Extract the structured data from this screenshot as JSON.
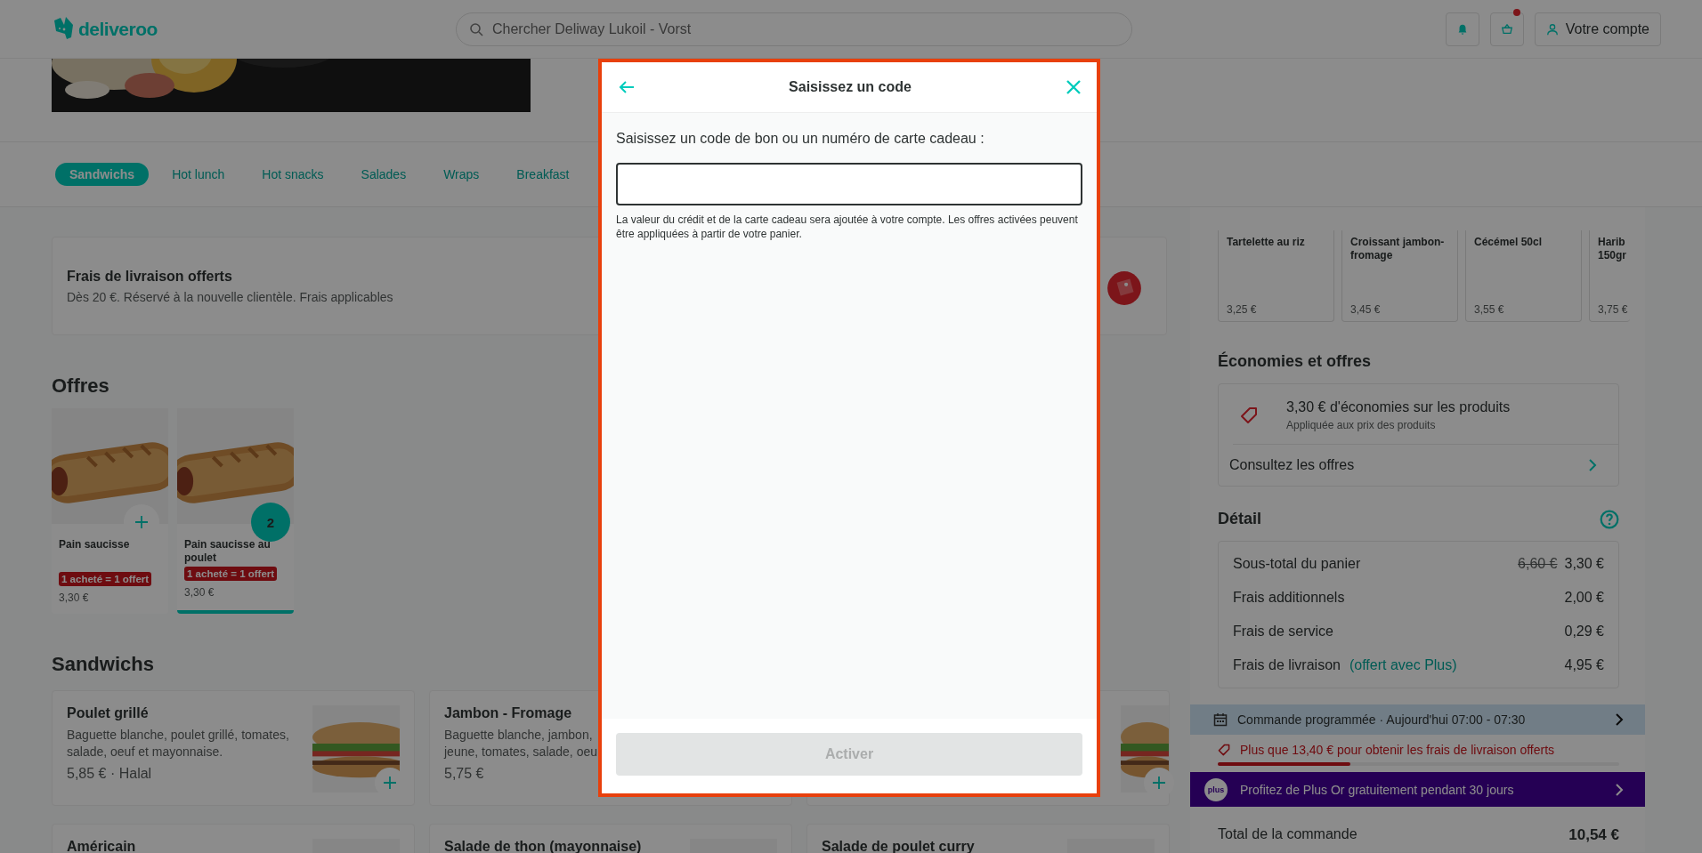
{
  "header": {
    "logo": "deliveroo",
    "search": {
      "placeholder": "Chercher Deliway Lukoil - Vorst"
    },
    "basket_dot": true,
    "account": "Votre compte"
  },
  "categories": [
    {
      "label": "Sandwichs",
      "selected": true
    },
    {
      "label": "Hot lunch",
      "selected": false
    },
    {
      "label": "Hot snacks",
      "selected": false
    },
    {
      "label": "Salades",
      "selected": false
    },
    {
      "label": "Wraps",
      "selected": false
    },
    {
      "label": "Breakfast",
      "selected": false
    }
  ],
  "promo": {
    "title": "Frais de livraison offerts",
    "text": "Dès 20 €. Réservé à la nouvelle clientèle. Frais applicables"
  },
  "offers": {
    "title": "Offres",
    "items": [
      {
        "name": "Pain saucisse",
        "badge": "1 acheté = 1 offert",
        "price": "3,30 €",
        "in_basket": false
      },
      {
        "name": "Pain saucisse au poulet",
        "badge": "1 acheté = 1 offert",
        "price": "3,30 €",
        "in_basket": true,
        "quantity": "2"
      }
    ]
  },
  "sandwiches": {
    "title": "Sandwichs",
    "items": [
      {
        "kind": "item",
        "name": "Poulet grillé",
        "description": [
          "Baguette blanche, poulet grillé, tomates,",
          "salade, oeuf et mayonnaise."
        ],
        "price": "5,85 € · Halal",
        "add_button": true
      },
      {
        "kind": "text_only",
        "name": "Jambon - Fromage",
        "description": [
          "Baguette blanche, jambon,",
          "jeune, tomates, salade, oeu"
        ],
        "price": "5,75 €"
      },
      {
        "kind": "image_only",
        "add_button": true
      },
      {
        "kind": "item",
        "name": "Américain"
      },
      {
        "kind": "item",
        "name": "Salade de thon (mayonnaise)"
      },
      {
        "kind": "item",
        "name": "Salade de poulet curry"
      }
    ]
  },
  "basket": {
    "upsell": [
      {
        "name": "Tartelette au riz",
        "price": "3,25 €"
      },
      {
        "name": "Croissant jambon-fromage",
        "price": "3,45 €"
      },
      {
        "name": "Cécémel 50cl",
        "price": "3,55 €"
      },
      {
        "name": "Harib\n150gr",
        "price": "3,75 €"
      }
    ],
    "savings": {
      "title": "Économies et offres",
      "headline": "3,30 € d'économies sur les produits",
      "sub": "Appliquée aux prix des produits",
      "link": "Consultez les offres"
    },
    "detail": {
      "title": "Détail",
      "rows": [
        {
          "label": "Sous-total du panier",
          "old_value": "6,60 €",
          "value": "3,30 €"
        },
        {
          "label": "Frais additionnels",
          "value": "2,00 €"
        },
        {
          "label": "Frais de service",
          "value": "0,29 €"
        },
        {
          "label": "Frais de livraison",
          "note": "(offert avec Plus)",
          "value": "4,95 €"
        }
      ]
    },
    "schedule": "Commande programmée · Aujourd'hui 07:00 - 07:30",
    "threshold": {
      "text": "Plus que 13,40 € pour obtenir les frais de livraison offerts",
      "level": 0.33
    },
    "plus_banner": {
      "badge": "plus",
      "text": "Profitez de Plus Or gratuitement pendant 30 jours"
    },
    "total": {
      "label": "Total de la commande",
      "value": "10,54 €"
    }
  },
  "modal": {
    "title": "Saisissez un code",
    "label": "Saisissez un code de bon ou un numéro de carte cadeau :",
    "help": "La valeur du crédit et de la carte cadeau sera ajoutée à votre compte. Les offres activées peuvent être appliquées à partir de votre panier.",
    "button": {
      "label": "Activer",
      "disabled": true
    }
  }
}
